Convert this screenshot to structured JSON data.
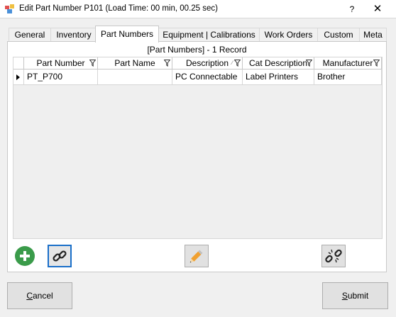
{
  "window": {
    "title": "Edit Part Number P101 (Load Time: 00 min, 00.25 sec)",
    "help_glyph": "?",
    "close_glyph": "✕"
  },
  "tabs": [
    {
      "label": "General",
      "active": false
    },
    {
      "label": "Inventory",
      "active": false
    },
    {
      "label": "Part Numbers",
      "active": true
    },
    {
      "label": "Equipment | Calibrations",
      "active": false
    },
    {
      "label": "Work Orders",
      "active": false
    },
    {
      "label": "Custom",
      "active": false
    },
    {
      "label": "Meta",
      "active": false
    }
  ],
  "grid": {
    "caption": "[Part Numbers] - 1 Record",
    "columns": [
      "Part Number",
      "Part Name",
      "Description",
      "Cat Description",
      "Manufacturer"
    ],
    "rows": [
      [
        "PT_P700",
        "",
        "PC Connectable",
        "Label Printers",
        "Brother"
      ]
    ]
  },
  "toolbar": {
    "add_icon": "add-icon",
    "link_icon": "link-icon",
    "edit_icon": "pencil-icon",
    "unlink_icon": "unlink-icon"
  },
  "footer": {
    "cancel_first": "C",
    "cancel_rest": "ancel",
    "submit_first": "S",
    "submit_rest": "ubmit"
  },
  "colors": {
    "accent_green": "#3a9b4a",
    "focus_blue": "#1a6fc9",
    "pencil_orange": "#f0a030"
  }
}
